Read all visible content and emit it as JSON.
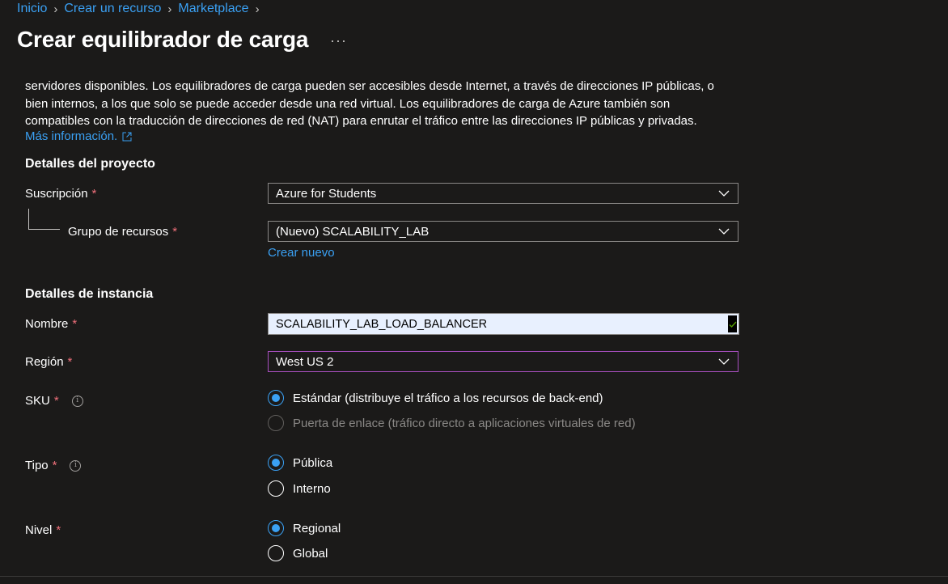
{
  "breadcrumb": [
    "Inicio",
    "Crear un recurso",
    "Marketplace"
  ],
  "page_title": "Crear equilibrador de carga",
  "more_label": "···",
  "description": {
    "lines": [
      "servidores disponibles. Los equilibradores de carga pueden ser accesibles desde Internet, a través de direcciones IP públicas, o",
      "bien internos, a los que solo se puede acceder desde una red virtual. Los equilibradores de carga de Azure también son",
      "compatibles con la traducción de direcciones de red (NAT) para enrutar el tráfico entre las direcciones IP públicas y privadas."
    ],
    "more_info": "Más información."
  },
  "project": {
    "title": "Detalles del proyecto",
    "subscription_label": "Suscripción",
    "subscription_value": "Azure for Students",
    "resource_group_label": "Grupo de recursos",
    "resource_group_value": "(Nuevo) SCALABILITY_LAB",
    "create_new": "Crear nuevo"
  },
  "instance": {
    "title": "Detalles de instancia",
    "name_label": "Nombre",
    "name_value": "SCALABILITY_LAB_LOAD_BALANCER",
    "region_label": "Región",
    "region_value": "West US 2",
    "sku_label": "SKU",
    "sku_options": [
      {
        "label": "Estándar (distribuye el tráfico a los recursos de back-end)",
        "checked": true,
        "disabled": false
      },
      {
        "label": "Puerta de enlace (tráfico directo a aplicaciones virtuales de red)",
        "checked": false,
        "disabled": true
      }
    ],
    "type_label": "Tipo",
    "type_options": [
      {
        "label": "Pública",
        "checked": true
      },
      {
        "label": "Interno",
        "checked": false
      }
    ],
    "tier_label": "Nivel",
    "tier_options": [
      {
        "label": "Regional",
        "checked": true
      },
      {
        "label": "Global",
        "checked": false
      }
    ]
  },
  "required_mark": "*",
  "info_mark": "i",
  "colors": {
    "background": "#1b1a19",
    "link": "#3aa0f3",
    "required": "#f1707b",
    "focus_border": "#a94fc0",
    "valid_check": "#57a300"
  },
  "icons": [
    "chevron-right-icon",
    "more-icon",
    "external-link-icon",
    "chevron-down-icon",
    "checkmark-icon",
    "info-icon"
  ]
}
